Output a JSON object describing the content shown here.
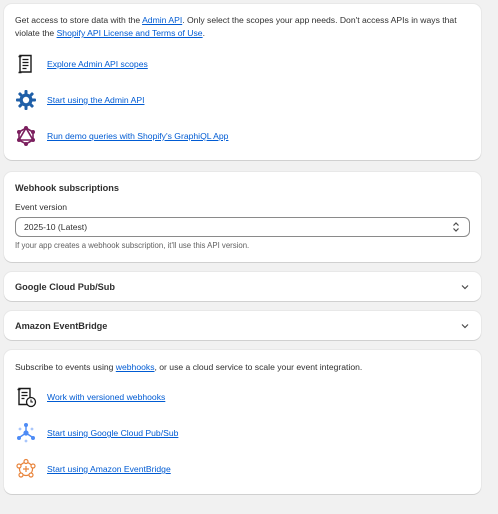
{
  "admin_api": {
    "intro_before_link1": "Get access to store data with the ",
    "link1": "Admin API",
    "intro_middle": ". Only select the scopes your app needs. Don't access APIs in ways that violate the ",
    "link2": "Shopify API License and Terms of Use",
    "intro_end": ".",
    "links": [
      {
        "label": "Explore Admin API scopes",
        "icon": "document-list-icon"
      },
      {
        "label": "Start using the Admin API",
        "icon": "gear-icon"
      },
      {
        "label": "Run demo queries with Shopify's GraphiQL App",
        "icon": "graphql-icon"
      }
    ]
  },
  "webhook": {
    "title": "Webhook subscriptions",
    "event_version_label": "Event version",
    "event_version_value": "2025-10 (Latest)",
    "help_text": "If your app creates a webhook subscription, it'll use this API version."
  },
  "google": {
    "title": "Google Cloud Pub/Sub"
  },
  "amazon": {
    "title": "Amazon EventBridge"
  },
  "events": {
    "intro_before_link": "Subscribe to events using ",
    "link": "webhooks",
    "intro_after_link": ", or use a cloud service to scale your event integration.",
    "links": [
      {
        "label": "Work with versioned webhooks",
        "icon": "document-clock-icon"
      },
      {
        "label": "Start using Google Cloud Pub/Sub",
        "icon": "google-pubsub-icon"
      },
      {
        "label": "Start using Amazon EventBridge",
        "icon": "amazon-eventbridge-icon"
      }
    ]
  },
  "colors": {
    "link": "#005bd3",
    "page_bg": "#f1f1f1",
    "graphql_pink": "#7b1f5e",
    "gear_blue": "#1f5fa8",
    "pubsub_blue": "#4d8bf5",
    "eventbridge_orange": "#e8833a"
  }
}
